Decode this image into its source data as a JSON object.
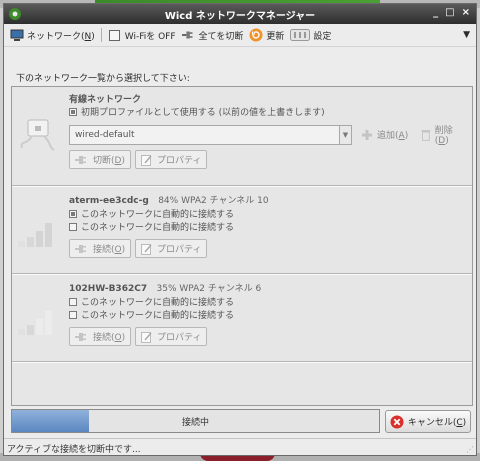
{
  "window": {
    "title": "Wicd ネットワークマネージャー",
    "controls": [
      "_",
      "□",
      "×"
    ]
  },
  "toolbar": {
    "network": "ネットワーク(",
    "network_key": "N",
    "network_end": ")",
    "wifi": "Wi-Fiを OFF",
    "disconnect_all": "全てを切断",
    "refresh": "更新",
    "settings": "設定",
    "menu_arrow": "▼"
  },
  "instruction": "下のネットワーク一覧から選択して下さい:",
  "wired": {
    "title": "有線ネットワーク",
    "default_profile_label": "初期プロファイルとして使用する (以前の値を上書きします)",
    "profile": "wired-default",
    "add_label": "追加(",
    "add_key": "A",
    "add_end": ")",
    "delete_label": "削除(",
    "delete_key": "D",
    "delete_end": ")",
    "disconnect_label": "切断(",
    "disconnect_key": "D",
    "disconnect_end": ")",
    "properties": "プロパティ"
  },
  "networks": [
    {
      "ssid": "aterm-ee3cdc-g",
      "info": "84%   WPA2   チャンネル 10",
      "auto1": "このネットワークに自動的に接続する",
      "auto2": "このネットワークに自動的に接続する",
      "auto1_checked": true,
      "auto2_checked": false,
      "connect_label": "接続(",
      "connect_key": "O",
      "connect_end": ")",
      "properties": "プロパティ"
    },
    {
      "ssid": "102HW-B362C7",
      "info": "35%   WPA2   チャンネル 6",
      "auto1": "このネットワークに自動的に接続する",
      "auto2": "このネットワークに自動的に接続する",
      "auto1_checked": false,
      "auto2_checked": false,
      "connect_label": "接続(",
      "connect_key": "O",
      "connect_end": ")",
      "properties": "プロパティ"
    }
  ],
  "progress": {
    "label": "接続中",
    "fraction": 0.21
  },
  "cancel": {
    "label": "キャンセル(",
    "key": "C",
    "end": ")"
  },
  "status": "アクティブな接続を切断中です...",
  "colors": {
    "progress": "#5b86c0",
    "titlebar": "#2e2e2e",
    "cancel_icon": "#d9302c",
    "refresh_icon": "#f0922a"
  }
}
